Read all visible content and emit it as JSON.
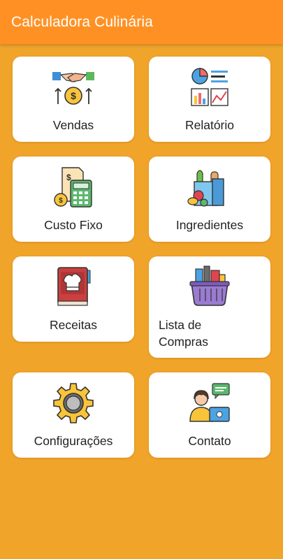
{
  "app": {
    "title": "Calculadora Culinária"
  },
  "menu": {
    "items": [
      {
        "id": "vendas",
        "label": "Vendas",
        "icon": "handshake-money-icon"
      },
      {
        "id": "relatorio",
        "label": "Relatório",
        "icon": "report-charts-icon"
      },
      {
        "id": "custo_fixo",
        "label": "Custo Fixo",
        "icon": "bill-calculator-icon"
      },
      {
        "id": "ingredientes",
        "label": "Ingredientes",
        "icon": "grocery-bag-icon"
      },
      {
        "id": "receitas",
        "label": "Receitas",
        "icon": "recipe-book-icon"
      },
      {
        "id": "lista_compras",
        "label_line1": "Lista de",
        "label_line2": "Compras",
        "icon": "shopping-basket-icon"
      },
      {
        "id": "configuracoes",
        "label": "Configurações",
        "icon": "gear-icon"
      },
      {
        "id": "contato",
        "label": "Contato",
        "icon": "support-agent-icon"
      }
    ]
  },
  "colors": {
    "appbar": "#FF9124",
    "background": "#F0A42A",
    "card": "#FFFFFF"
  }
}
